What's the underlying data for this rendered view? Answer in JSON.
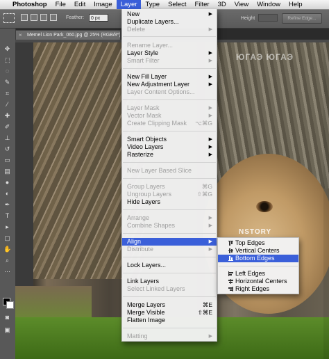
{
  "menubar": {
    "apple_icon": "apple-logo-icon",
    "app_name": "Photoshop",
    "items": [
      "File",
      "Edit",
      "Image",
      "Layer",
      "Type",
      "Select",
      "Filter",
      "3D",
      "View",
      "Window",
      "Help"
    ],
    "active_item": "Layer",
    "accent_color": "#3a5fd9"
  },
  "optionsbar": {
    "feather_label": "Feather:",
    "feather_value": "0 px",
    "height_label": "Height",
    "refine_edge_label": "Refine Edge..."
  },
  "document": {
    "tab_title": "Memel Lion Park_060.jpg @ 25% (RGB/8*)",
    "close_icon": "close-icon"
  },
  "watermark": {
    "text_top": "ЮГАЭ ЮГАЭ",
    "text_mid": "NSTORY"
  },
  "layer_menu": {
    "items": [
      {
        "label": "New",
        "submenu": true,
        "enabled": true
      },
      {
        "label": "Duplicate Layers...",
        "enabled": true
      },
      {
        "label": "Delete",
        "submenu": true,
        "enabled": false
      },
      {
        "label": "Rename Layer...",
        "enabled": false
      },
      {
        "label": "Layer Style",
        "submenu": true,
        "enabled": true
      },
      {
        "label": "Smart Filter",
        "submenu": true,
        "enabled": false
      },
      {
        "label": "New Fill Layer",
        "submenu": true,
        "enabled": true
      },
      {
        "label": "New Adjustment Layer",
        "submenu": true,
        "enabled": true
      },
      {
        "label": "Layer Content Options...",
        "enabled": false
      },
      {
        "label": "Layer Mask",
        "submenu": true,
        "enabled": false
      },
      {
        "label": "Vector Mask",
        "submenu": true,
        "enabled": false
      },
      {
        "label": "Create Clipping Mask",
        "shortcut": "⌥⌘G",
        "enabled": false
      },
      {
        "label": "Smart Objects",
        "submenu": true,
        "enabled": true
      },
      {
        "label": "Video Layers",
        "submenu": true,
        "enabled": true
      },
      {
        "label": "Rasterize",
        "submenu": true,
        "enabled": true
      },
      {
        "label": "New Layer Based Slice",
        "enabled": false
      },
      {
        "label": "Group Layers",
        "shortcut": "⌘G",
        "enabled": false
      },
      {
        "label": "Ungroup Layers",
        "shortcut": "⇧⌘G",
        "enabled": false
      },
      {
        "label": "Hide Layers",
        "enabled": true
      },
      {
        "label": "Arrange",
        "submenu": true,
        "enabled": false
      },
      {
        "label": "Combine Shapes",
        "submenu": true,
        "enabled": false
      },
      {
        "label": "Align",
        "submenu": true,
        "enabled": true,
        "highlighted": true
      },
      {
        "label": "Distribute",
        "submenu": true,
        "enabled": false
      },
      {
        "label": "Lock Layers...",
        "enabled": true
      },
      {
        "label": "Link Layers",
        "enabled": true
      },
      {
        "label": "Select Linked Layers",
        "enabled": false
      },
      {
        "label": "Merge Layers",
        "shortcut": "⌘E",
        "enabled": true
      },
      {
        "label": "Merge Visible",
        "shortcut": "⇧⌘E",
        "enabled": true
      },
      {
        "label": "Flatten Image",
        "enabled": true
      },
      {
        "label": "Matting",
        "submenu": true,
        "enabled": false
      }
    ]
  },
  "align_submenu": {
    "items": [
      {
        "label": "Top Edges",
        "icon": "align-top-edges-icon"
      },
      {
        "label": "Vertical Centers",
        "icon": "align-vertical-centers-icon"
      },
      {
        "label": "Bottom Edges",
        "icon": "align-bottom-edges-icon",
        "highlighted": true
      },
      {
        "label": "Left Edges",
        "icon": "align-left-edges-icon"
      },
      {
        "label": "Horizontal Centers",
        "icon": "align-horizontal-centers-icon"
      },
      {
        "label": "Right Edges",
        "icon": "align-right-edges-icon"
      }
    ]
  }
}
